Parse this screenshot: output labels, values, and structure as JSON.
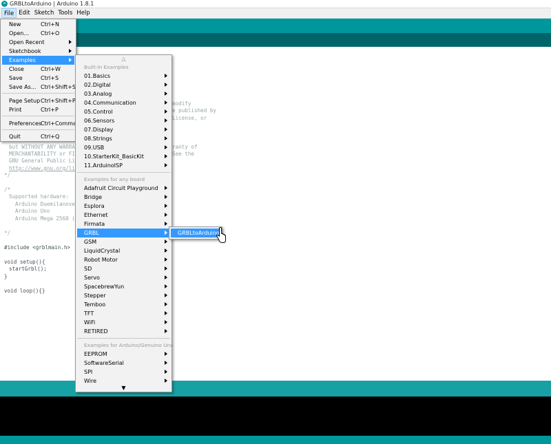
{
  "window": {
    "title": "GRBLtoArduino | Arduino 1.8.1",
    "app_icon_glyph": "∞"
  },
  "menubar": {
    "items": [
      "File",
      "Edit",
      "Sketch",
      "Tools",
      "Help"
    ]
  },
  "editor": {
    "lines": [
      "modify",
      "e published by",
      "License, or",
      "but WITHOUT ANY WARRAN",
      "ranty of",
      "MERCHANTABILITY or FIT",
      "See the",
      "GNU General Public Lic",
      "http://www.gnu.org/lic",
      "*/",
      "/*",
      "Supported hardware:",
      "Arduino Duemilanove",
      "Arduino Uno",
      "Arduino Mega 2560 (L",
      "*/",
      "#include <grblmain.h>",
      "void setup(){",
      "startGrbl();",
      "}",
      "void loop(){}"
    ]
  },
  "file_menu": {
    "items": [
      {
        "label": "New",
        "accel": "Ctrl+N"
      },
      {
        "label": "Open...",
        "accel": "Ctrl+O"
      },
      {
        "label": "Open Recent",
        "accel": ""
      },
      {
        "label": "Sketchbook",
        "accel": ""
      },
      {
        "label": "Examples",
        "accel": ""
      },
      {
        "label": "Close",
        "accel": "Ctrl+W"
      },
      {
        "label": "Save",
        "accel": "Ctrl+S"
      },
      {
        "label": "Save As...",
        "accel": "Ctrl+Shift+S"
      },
      {
        "label": "Page Setup",
        "accel": "Ctrl+Shift+P"
      },
      {
        "label": "Print",
        "accel": "Ctrl+P"
      },
      {
        "label": "Preferences",
        "accel": "Ctrl+Comma"
      },
      {
        "label": "Quit",
        "accel": "Ctrl+Q"
      }
    ]
  },
  "examples_menu": {
    "scroll_up": "△",
    "scroll_down": "▼",
    "builtin_header": "Built-in Examples",
    "builtin": [
      "01.Basics",
      "02.Digital",
      "03.Analog",
      "04.Communication",
      "05.Control",
      "06.Sensors",
      "07.Display",
      "08.Strings",
      "09.USB",
      "10.StarterKit_BasicKit",
      "11.ArduinoISP"
    ],
    "anyboard_header": "Examples for any board",
    "anyboard": [
      "Adafruit Circuit Playground",
      "Bridge",
      "Esplora",
      "Ethernet",
      "Firmata",
      "GRBL",
      "GSM",
      "LiquidCrystal",
      "Robot Motor",
      "SD",
      "Servo",
      "SpacebrewYun",
      "Stepper",
      "Temboo",
      "TFT",
      "WiFi",
      "RETIRED"
    ],
    "uno_header": "Examples for Arduino/Genuino Uno",
    "uno": [
      "EEPROM",
      "SoftwareSerial",
      "SPI",
      "Wire"
    ]
  },
  "grbl_submenu": {
    "items": [
      "GRBLtoArduino"
    ]
  },
  "colors": {
    "teal": "#00979c",
    "dark_teal": "#006468",
    "highlight": "#3399ff"
  }
}
